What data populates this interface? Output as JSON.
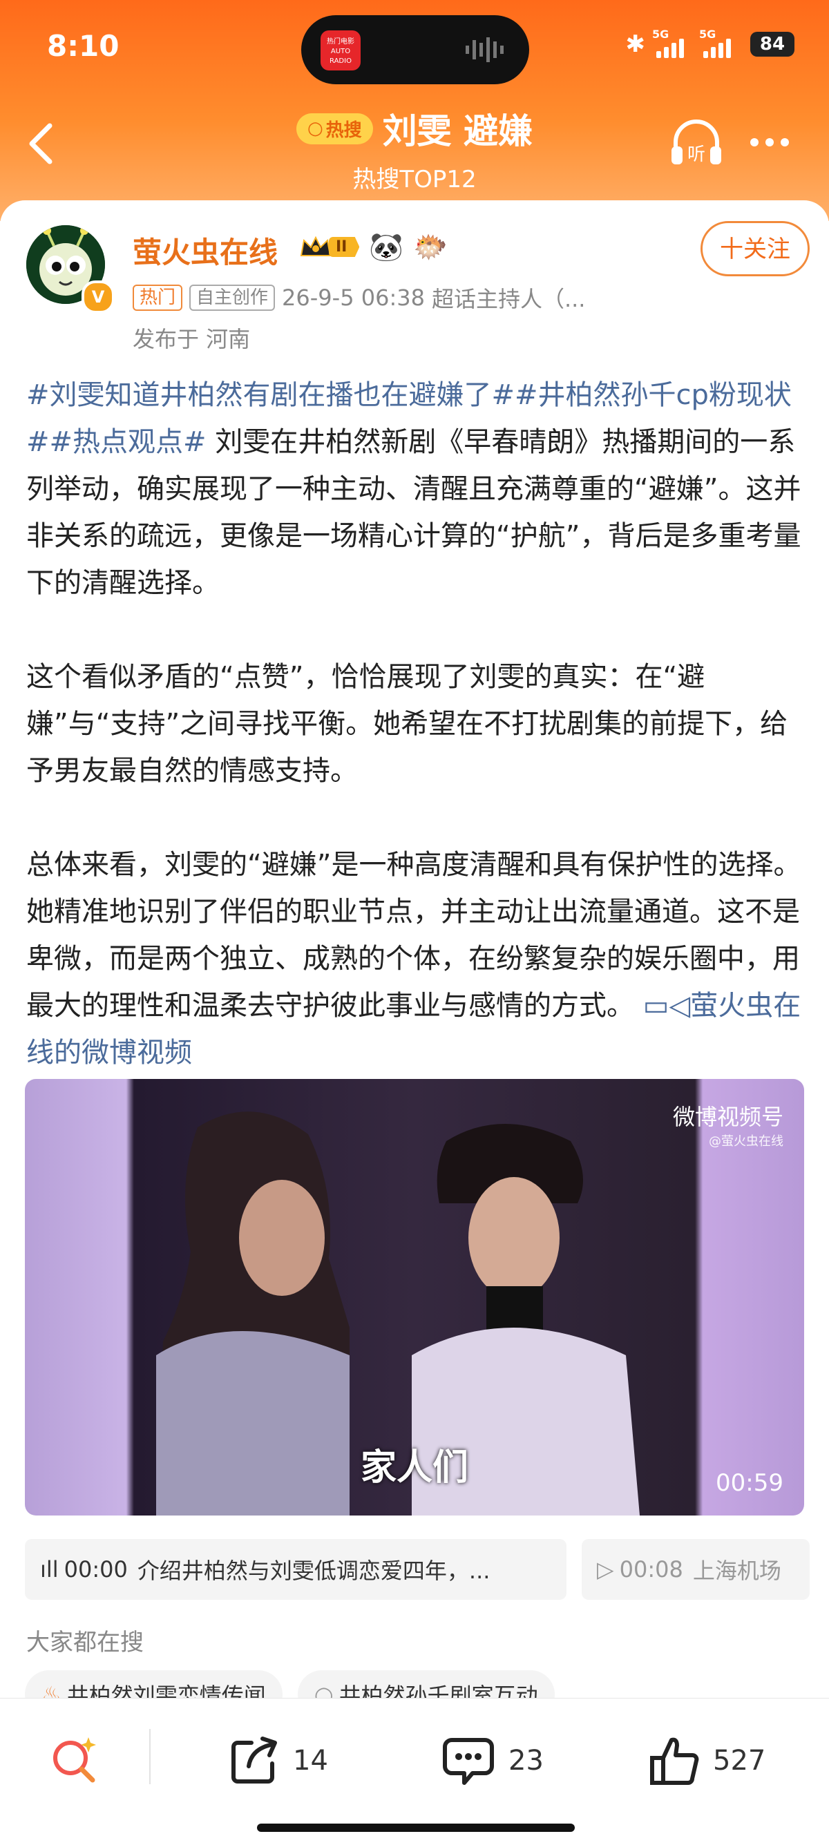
{
  "status_bar": {
    "time": "8:10",
    "island_app": "热门电影 AUTO RADIO",
    "network_1": "5G",
    "network_2": "5G",
    "battery": "84"
  },
  "header": {
    "hot_badge": "热搜",
    "title": "刘雯 避嫌",
    "subtitle": "热搜TOP12",
    "headphone_label": "听"
  },
  "post": {
    "author": "萤火虫在线",
    "rank_level": "II",
    "verified_mark": "V",
    "follow_label": "十关注",
    "tag_hot": "热门",
    "tag_original": "自主创作",
    "datetime": "26-9-5 06:38",
    "source": "超话主持人（...",
    "location": "发布于 河南",
    "hashtags": "#刘雯知道井柏然有剧在播也在避嫌了##井柏然孙千cp粉现状##热点观点#",
    "p1_text": " 刘雯在井柏然新剧《早春晴朗》热播期间的一系列举动，确实展现了一种主动、清醒且充满尊重的“避嫌”。这并非关系的疏远，更像是一场精心计算的“护航”，背后是多重考量下的清醒选择。",
    "p2": "这个看似矛盾的“点赞”，恰恰展现了刘雯的真实：在“避嫌”与“支持”之间寻找平衡。她希望在不打扰剧集的前提下，给予男友最自然的情感支持。",
    "p3_text": "总体来看，刘雯的“避嫌”是一种高度清醒和具有保护性的选择。她精准地识别了伴侣的职业节点，并主动让出流量通道。这不是卑微，而是两个独立、成熟的个体，在纷繁复杂的娱乐圈中，用最大的理性和温柔去守护彼此事业与感情的方式。",
    "video_link": "萤火虫在线的微博视频"
  },
  "video": {
    "watermark": "微博视频号",
    "watermark_sub": "@萤火虫在线",
    "caption": "家人们",
    "duration": "00:59"
  },
  "chapters": [
    {
      "time": "00:00",
      "text": "介绍井柏然与刘雯低调恋爱四年，..."
    },
    {
      "time": "00:08",
      "text": "上海机场"
    }
  ],
  "everyone_searching": {
    "label": "大家都在搜",
    "items": [
      "井柏然刘雯恋情传闻",
      "井柏然孙千剧室互动"
    ]
  },
  "bottom_bar": {
    "share_count": "14",
    "comment_count": "23",
    "like_count": "527"
  }
}
